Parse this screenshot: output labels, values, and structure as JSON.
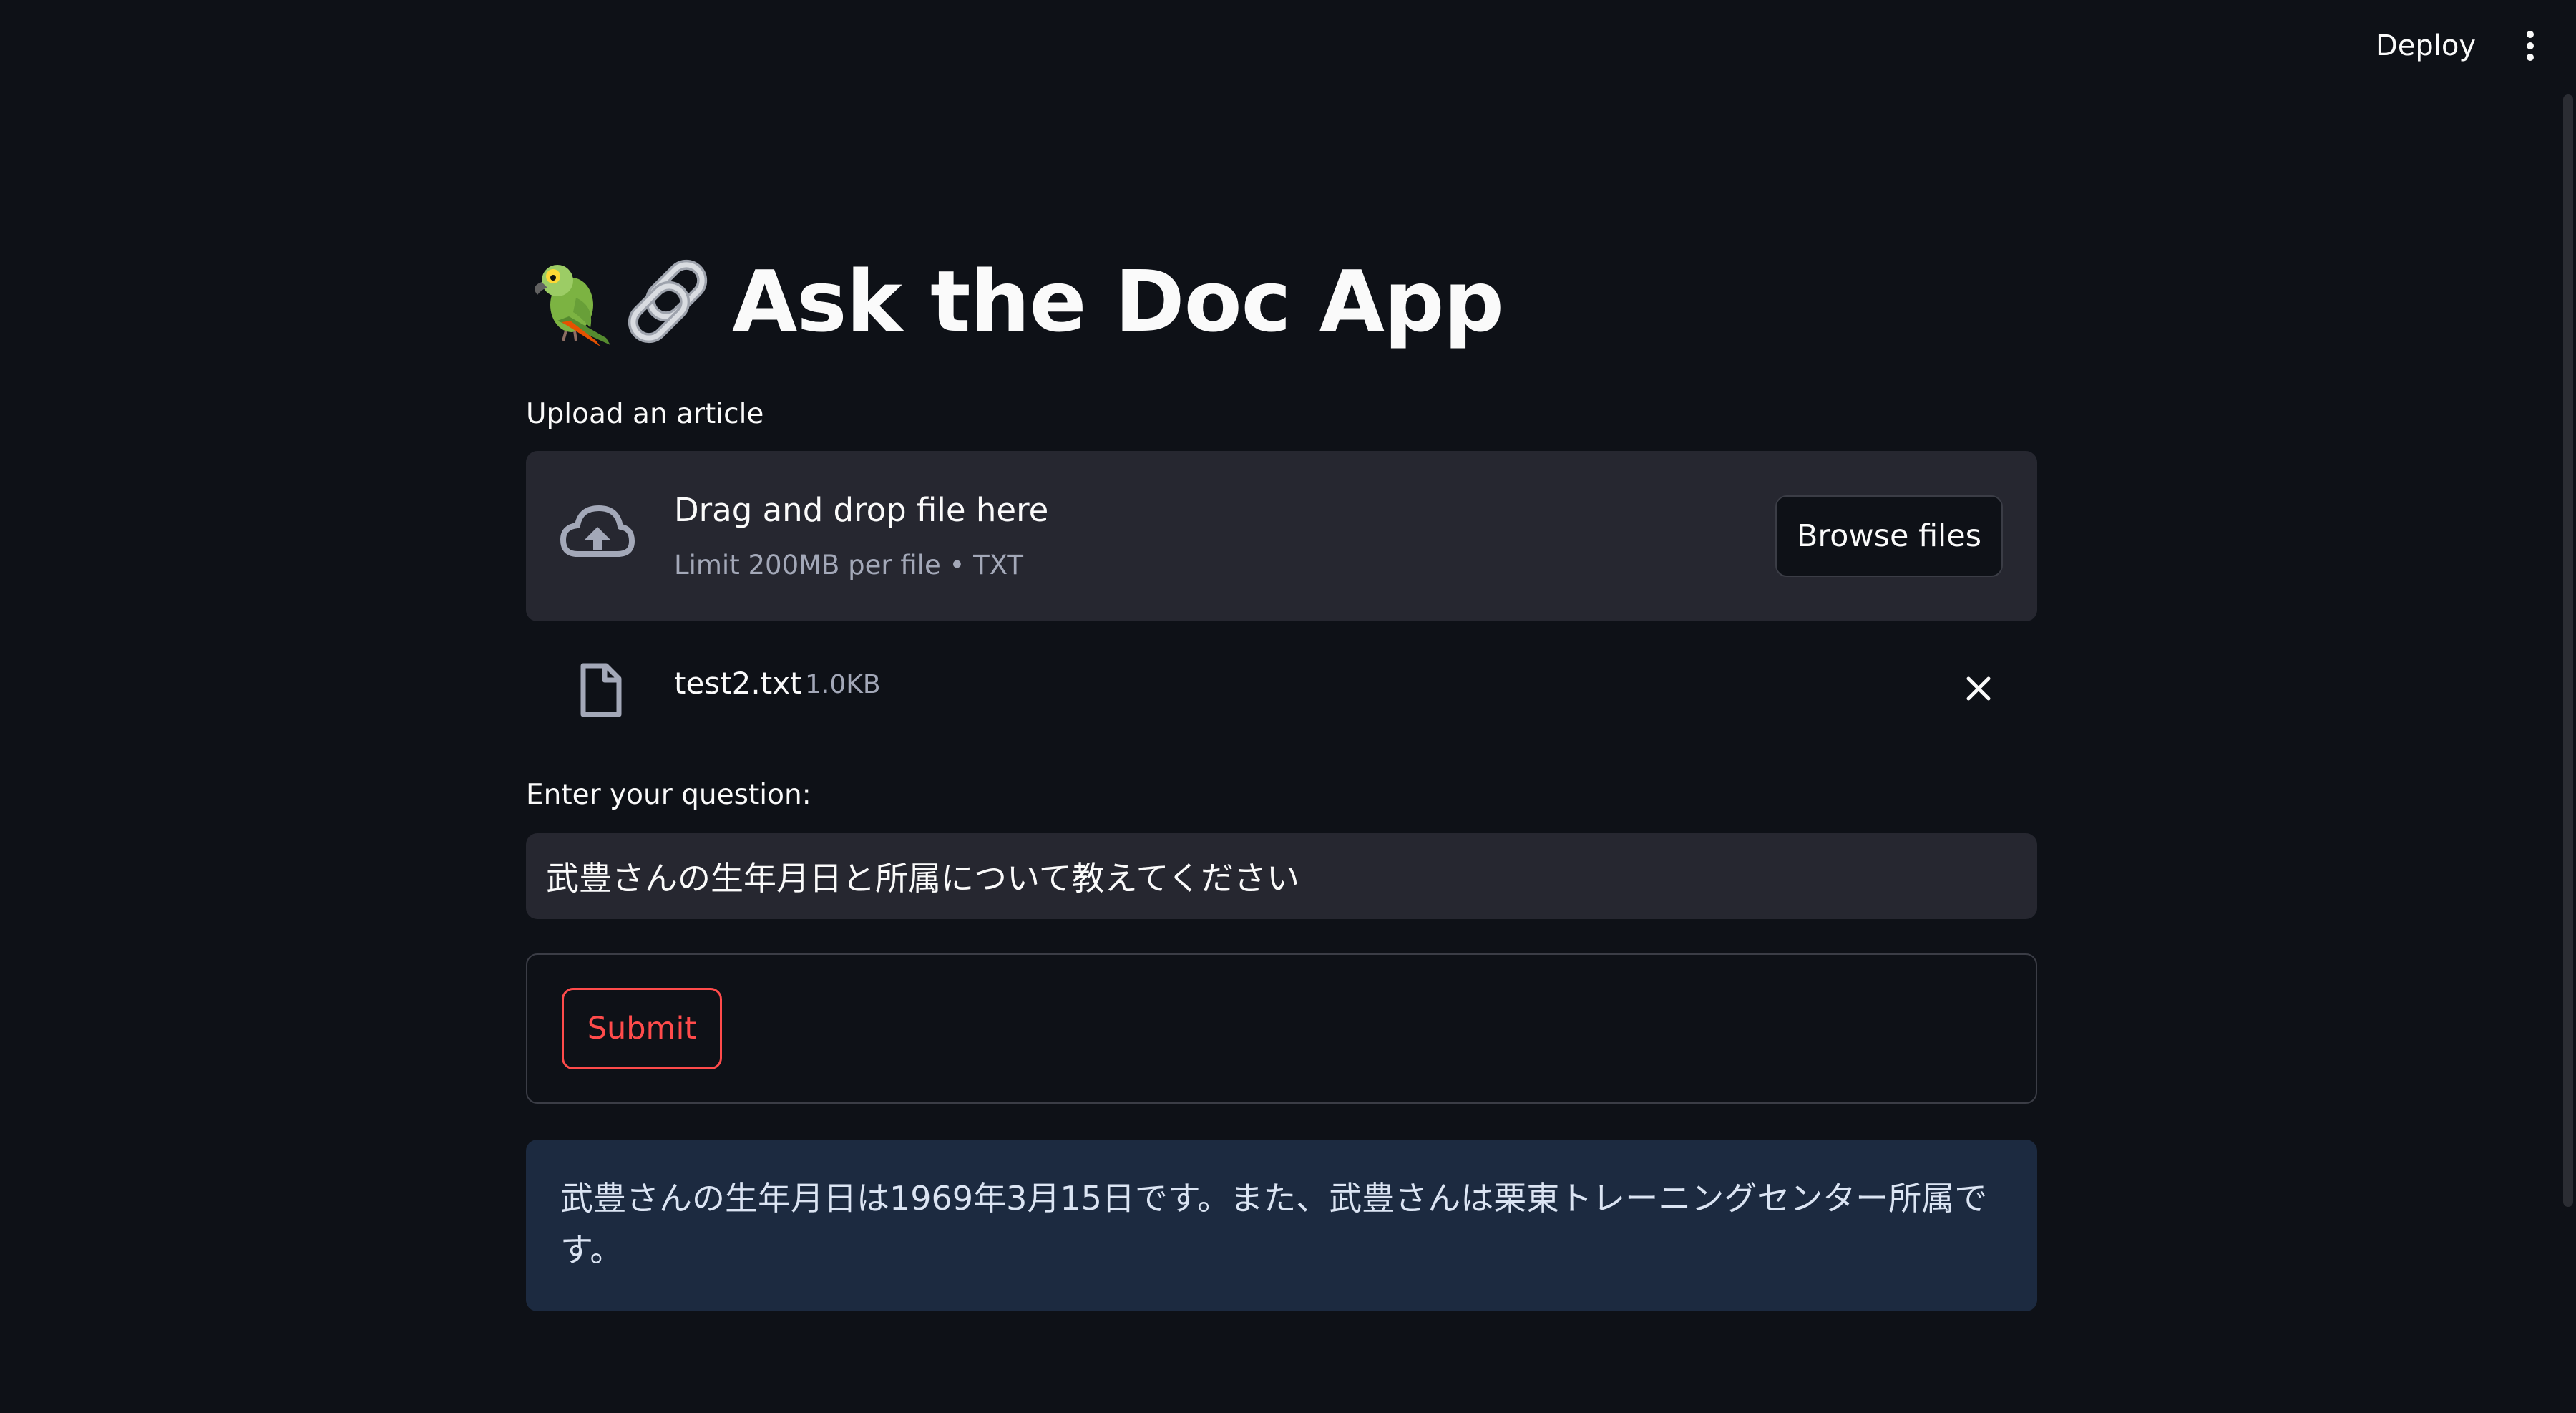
{
  "header": {
    "deploy_label": "Deploy",
    "menu_icon": "kebab-menu-icon"
  },
  "app": {
    "title": "Ask the Doc App",
    "title_icons": [
      "parrot-icon",
      "link-icon"
    ]
  },
  "uploader": {
    "label": "Upload an article",
    "drag_text": "Drag and drop file here",
    "limit_text": "Limit 200MB per file • TXT",
    "browse_label": "Browse files",
    "icon": "cloud-upload-icon"
  },
  "uploaded_file": {
    "name": "test2.txt",
    "size": "1.0KB",
    "icon": "file-icon",
    "remove_icon": "close-icon"
  },
  "question": {
    "label": "Enter your question:",
    "value": "武豊さんの生年月日と所属について教えてください"
  },
  "form": {
    "submit_label": "Submit"
  },
  "answer": {
    "text": "武豊さんの生年月日は1969年3月15日です。また、武豊さんは栗東トレーニングセンター所属です。"
  },
  "colors": {
    "background": "#0e1117",
    "surface": "#262730",
    "accent": "#ff4b4b",
    "info_bg": "#1c2a40"
  }
}
